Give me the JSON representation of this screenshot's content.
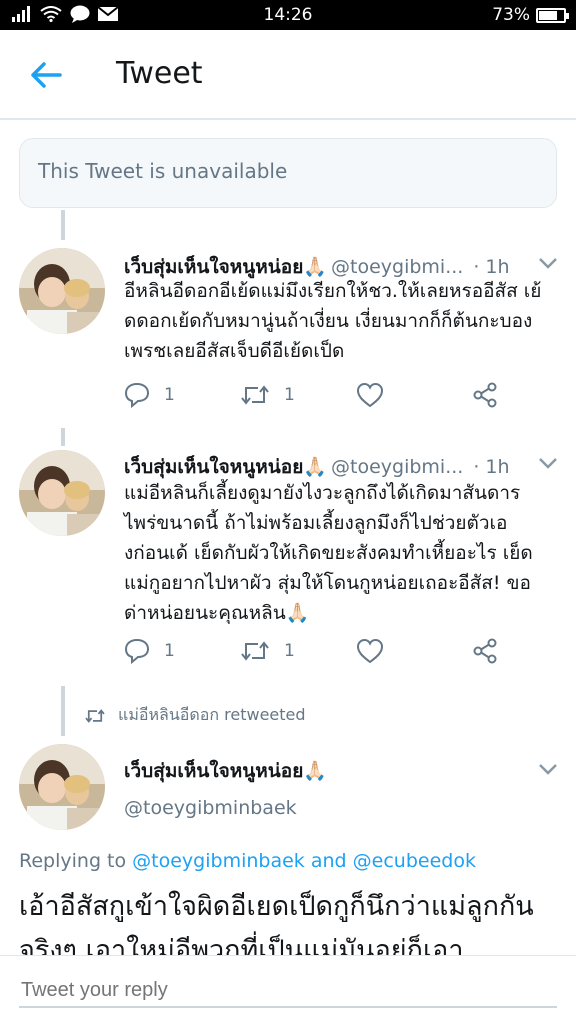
{
  "status_bar": {
    "time": "14:26",
    "battery": "73%",
    "battery_level": 0.73
  },
  "header": {
    "title": "Tweet"
  },
  "unavailable_notice": "This Tweet is unavailable",
  "tweets": [
    {
      "name": "เว็บสุ่มเห็นใจหนูหน่อย🙏🏻",
      "handle": "@toeygibmi...",
      "time": "· 1h",
      "text": "อีหลินอีดอกอีเย้ดแม่มึงเรียกให้ชว.ให้เลยหรออีสัส เย้ดดอกเย้ดกับหมานู่นถ้าเงี่ยน เงี่ยนมากก็ก็ต้นกะบองเพรชเลยอีสัสเจ็บดีอีเย้ดเป็ด",
      "replies": "1",
      "retweets": "1"
    },
    {
      "name": "เว็บสุ่มเห็นใจหนูหน่อย🙏🏻",
      "handle": "@toeygibmi...",
      "time": "· 1h",
      "text": "แม่อีหลินก็เลี้ยงดูมายังไงวะลูกถึงได้เกิดมาสันดารไพร่ขนาดนี้ ถ้าไม่พร้อมเลี้ยงลูกมึงก็ไปช่วยตัวเองก่อนเด้ เย็ดกับผัวให้เกิดขยะสังคมทำเหี้ยอะไร เย็ดแม่กูอยากไปหาผัว สุ่มให้โดนกูหน่อยเถอะอีสัส! ขอด่าหน่อยนะคุณหลิน🙏🏻",
      "replies": "1",
      "retweets": "1"
    }
  ],
  "retweeted_by": "แม่อีหลินอีดอก retweeted",
  "main_tweet": {
    "name": "เว็บสุ่มเห็นใจหนูหน่อย🙏🏻",
    "handle": "@toeygibminbaek",
    "replying_prefix": "Replying to",
    "reply_user1": "@toeygibminbaek",
    "reply_and": "and",
    "reply_user2": "@ecubeedok",
    "text": "เอ้าอีสัสกูเข้าใจผิดอีเยดเป็ดกูก็นึกว่าแม่ลูกกันจริงๆ เอาใหม่อีพวกที่เป็นแม่มันอยู่ก็เอา"
  },
  "reply_box": {
    "placeholder": "Tweet your reply"
  },
  "colors": {
    "accent": "#1da1f2",
    "muted": "#657786",
    "border": "#e1e8ed"
  }
}
